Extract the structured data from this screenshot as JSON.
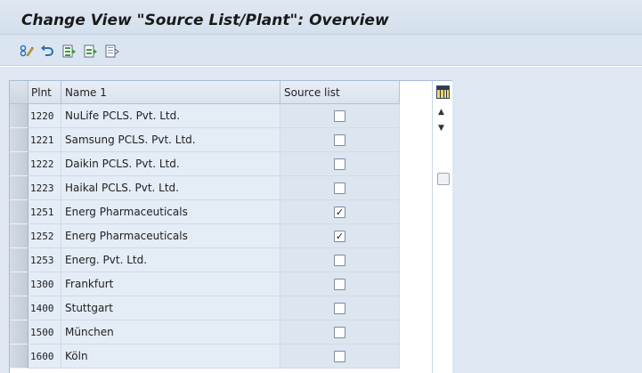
{
  "header": {
    "title": "Change View \"Source List/Plant\": Overview"
  },
  "toolbar": {
    "buttons": [
      {
        "icon": "display-change-icon",
        "label": ""
      },
      {
        "icon": "undo-icon",
        "label": ""
      },
      {
        "icon": "select-all-icon",
        "label": ""
      },
      {
        "icon": "select-block-icon",
        "label": ""
      },
      {
        "icon": "deselect-all-icon",
        "label": ""
      }
    ]
  },
  "table": {
    "columns": {
      "plant": "Plnt",
      "name": "Name 1",
      "source_list": "Source list"
    },
    "rows": [
      {
        "plant": "1220",
        "name": "NuLife PCLS. Pvt. Ltd.",
        "source_list": false
      },
      {
        "plant": "1221",
        "name": "Samsung PCLS. Pvt. Ltd.",
        "source_list": false
      },
      {
        "plant": "1222",
        "name": "Daikin PCLS. Pvt. Ltd.",
        "source_list": false
      },
      {
        "plant": "1223",
        "name": "Haikal PCLS. Pvt. Ltd.",
        "source_list": false
      },
      {
        "plant": "1251",
        "name": "Energ Pharmaceuticals",
        "source_list": true
      },
      {
        "plant": "1252",
        "name": "Energ Pharmaceuticals",
        "source_list": true
      },
      {
        "plant": "1253",
        "name": "Energ. Pvt. Ltd.",
        "source_list": false
      },
      {
        "plant": "1300",
        "name": "Frankfurt",
        "source_list": false
      },
      {
        "plant": "1400",
        "name": "Stuttgart",
        "source_list": false
      },
      {
        "plant": "1500",
        "name": "München",
        "source_list": false
      },
      {
        "plant": "1600",
        "name": "Köln",
        "source_list": false
      }
    ],
    "checkmark_glyph": "✓"
  }
}
